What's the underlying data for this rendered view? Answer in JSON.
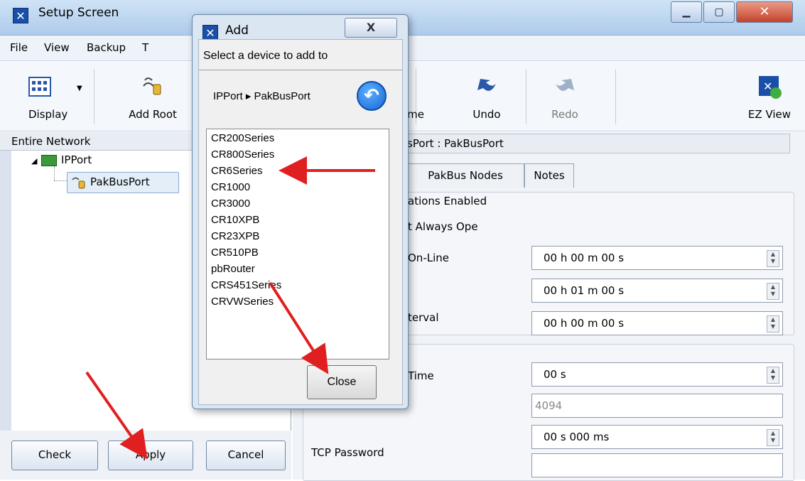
{
  "window": {
    "title": "Setup Screen",
    "icon": "app-icon",
    "controls": [
      "minimize",
      "maximize",
      "close"
    ]
  },
  "menu": [
    {
      "label": "File"
    },
    {
      "label": "View"
    },
    {
      "label": "Backup"
    },
    {
      "label": "T"
    }
  ],
  "toolbar": {
    "display": "Display",
    "add_root": "Add Root",
    "rename": "me",
    "undo": "Undo",
    "redo": "Redo",
    "ez_view": "EZ View"
  },
  "tree": {
    "header": "Entire Network",
    "root": "IPPort",
    "child": "PakBusPort"
  },
  "buttons": {
    "check": "Check",
    "apply": "Apply",
    "cancel": "Cancel"
  },
  "right": {
    "header": "sPort : PakBusPort",
    "tabs": [
      "PakBus Nodes",
      "Notes"
    ],
    "communications_enabled": "ations Enabled",
    "always_open": "t Always Ope",
    "on_line": "On-Line",
    "interval": "terval",
    "time": "Time",
    "tcp_password": "TCP Password",
    "field1": "00 h 00 m 00 s",
    "field2": "00 h 01 m 00 s",
    "field3": "00 h 00 m 00 s",
    "field4": "00 s",
    "field5": "4094",
    "field6": "00 s 000 ms",
    "field7": ""
  },
  "dialog": {
    "title": "Add",
    "close_x": "X",
    "prompt": "Select a device to add to",
    "path": "IPPort ▸ PakBusPort",
    "back_icon": "back-arrow-icon",
    "devices": [
      "CR200Series",
      "CR800Series",
      "CR6Series",
      "CR1000",
      "CR3000",
      "CR10XPB",
      "CR23XPB",
      "CR510PB",
      "pbRouter",
      "CRS451Series",
      "CRVWSeries"
    ],
    "close_button": "Close"
  },
  "colors": {
    "annotation_arrow": "#e02020",
    "title_bar": "#b8d2ee",
    "accent": "#1565d6"
  }
}
